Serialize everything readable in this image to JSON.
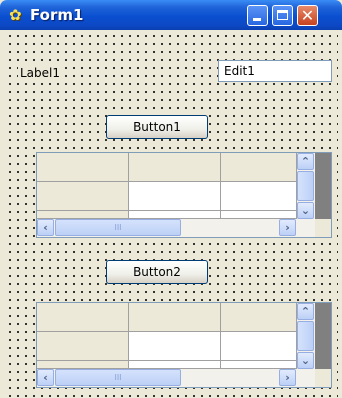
{
  "window": {
    "title": "Form1",
    "icons": [
      "form-icon",
      "minimize-icon",
      "maximize-icon",
      "close-icon"
    ]
  },
  "form": {
    "label1": "Label1",
    "edit1": "Edit1",
    "button1": "Button1",
    "button2": "Button2",
    "grid_thumb_text": "III"
  },
  "colors": {
    "titlebar": "#0a4fd0",
    "form_background": "#ece9d8",
    "edit_border": "#7f9db9"
  }
}
